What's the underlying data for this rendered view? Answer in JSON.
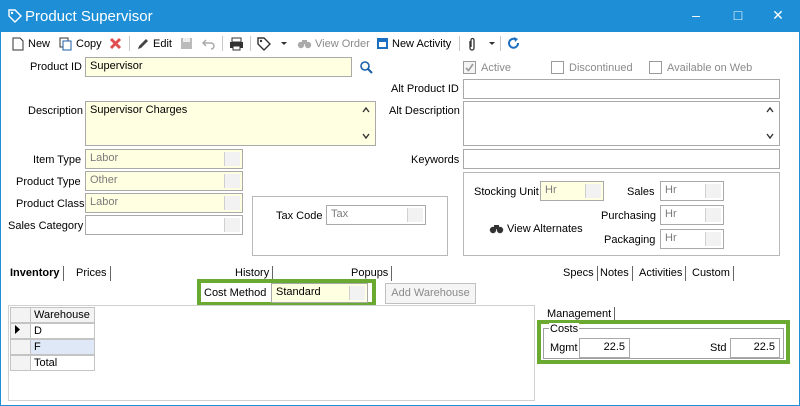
{
  "window": {
    "title": "Product Supervisor"
  },
  "toolbar": {
    "new_label": "New",
    "copy_label": "Copy",
    "edit_label": "Edit",
    "view_order_label": "View Order",
    "new_activity_label": "New Activity"
  },
  "form": {
    "product_id_label": "Product ID",
    "product_id_value": "Supervisor",
    "description_label": "Description",
    "description_value": "Supervisor Charges",
    "item_type_label": "Item Type",
    "item_type_value": "Labor",
    "product_type_label": "Product Type",
    "product_type_value": "Other",
    "product_class_label": "Product Class",
    "product_class_value": "Labor",
    "sales_category_label": "Sales Category",
    "sales_category_value": "",
    "tax_code_label": "Tax Code",
    "tax_code_value": "Tax",
    "active_label": "Active",
    "active_checked": true,
    "discontinued_label": "Discontinued",
    "available_on_web_label": "Available on Web",
    "alt_product_id_label": "Alt Product ID",
    "alt_product_id_value": "",
    "alt_description_label": "Alt Description",
    "alt_description_value": "",
    "keywords_label": "Keywords",
    "keywords_value": "",
    "stocking_unit_label": "Stocking Unit",
    "stocking_unit_value": "Hr",
    "sales_label": "Sales",
    "sales_value": "Hr",
    "purchasing_label": "Purchasing",
    "purchasing_value": "Hr",
    "packaging_label": "Packaging",
    "packaging_value": "Hr",
    "view_alternates_label": "View Alternates"
  },
  "tabs_left": [
    "Inventory",
    "Prices"
  ],
  "tabs_mid": [
    "History",
    "Popups"
  ],
  "tabs_right": [
    "Specs",
    "Notes",
    "Activities",
    "Custom"
  ],
  "inventory": {
    "cost_method_label": "Cost Method",
    "cost_method_value": "Standard",
    "add_warehouse_label": "Add Warehouse",
    "grid_header": "Warehouse",
    "rows": [
      "D",
      "F",
      "Total"
    ]
  },
  "management": {
    "tab_label": "Management",
    "costs_label": "Costs",
    "mgmt_label": "Mgmt",
    "mgmt_value": "22.5",
    "std_label": "Std",
    "std_value": "22.5"
  },
  "colors": {
    "titlebar": "#1e8fd6",
    "highlight": "#6aaa30",
    "field_yellow": "#ffffe1"
  }
}
